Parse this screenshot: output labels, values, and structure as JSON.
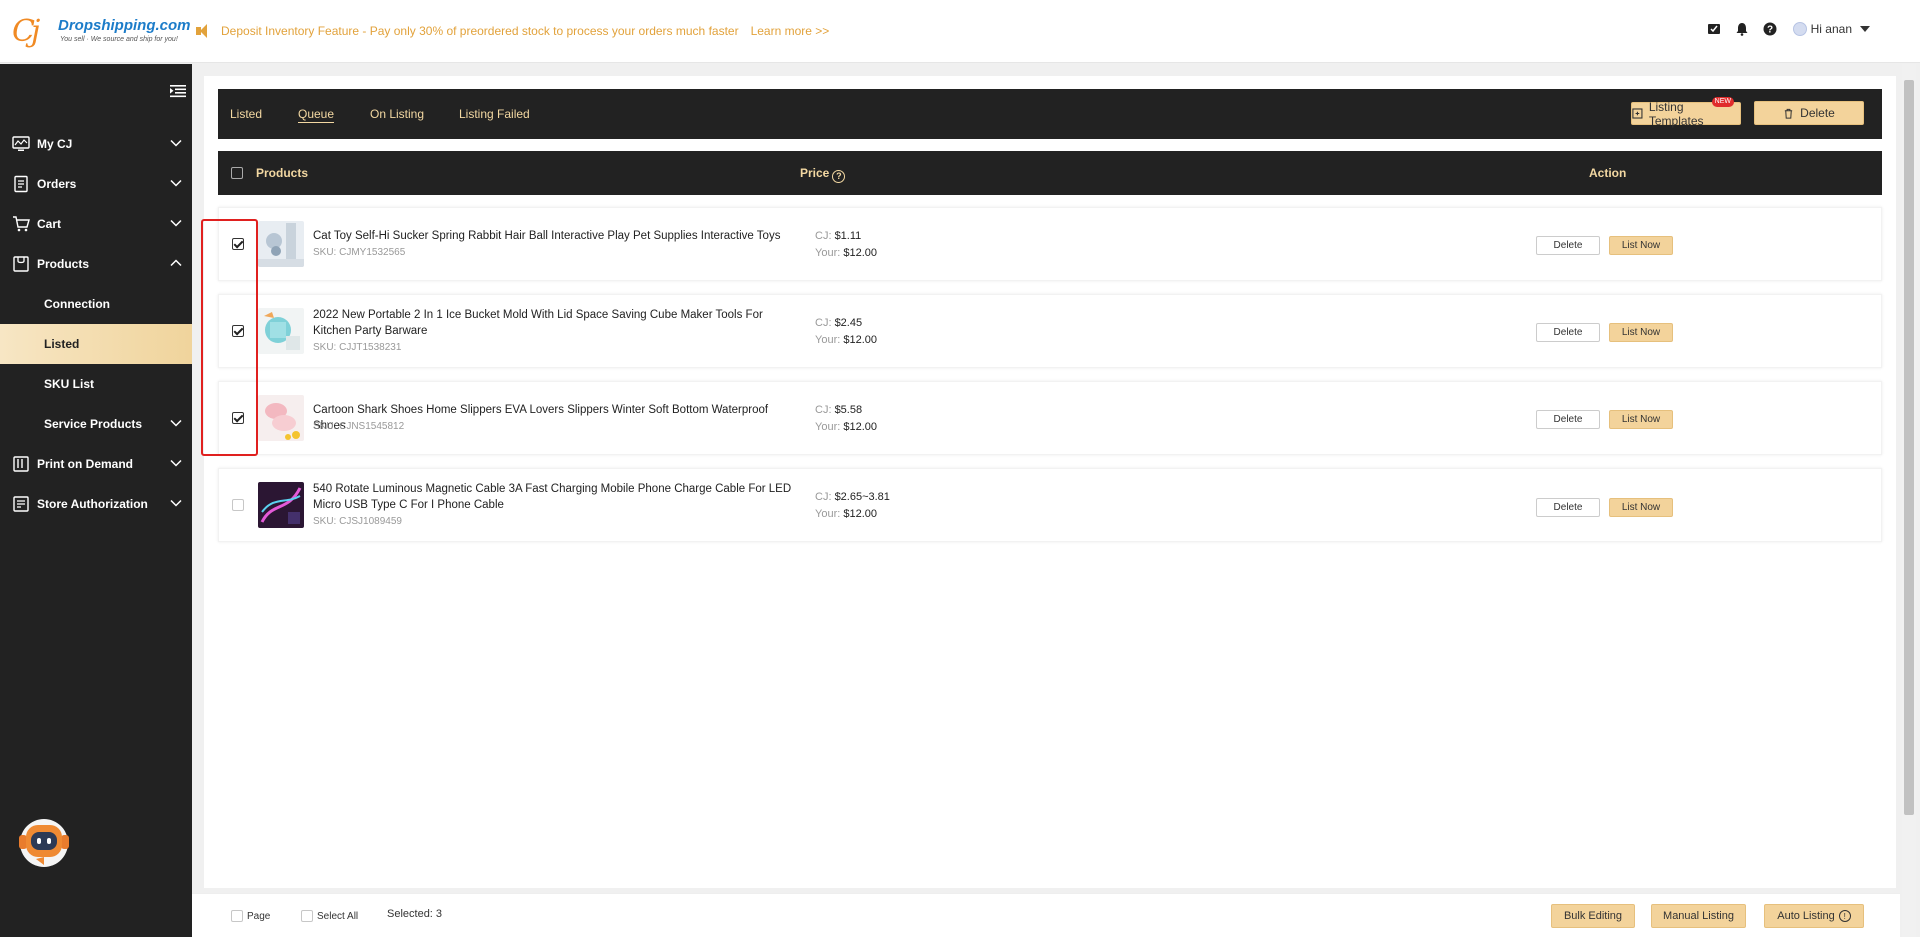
{
  "header": {
    "logo_brand": "Dropshipping.com",
    "logo_tagline": "You sell · We source and ship for you!",
    "announcement": "Deposit Inventory Feature - Pay only 30% of preordered stock to process your orders much faster",
    "learn_more": "Learn more >>",
    "greeting": "Hi anan",
    "icons": [
      "message-icon",
      "bell-icon",
      "help-icon"
    ]
  },
  "sidebar": {
    "items": [
      {
        "label": "My CJ",
        "icon": "monitor-icon",
        "expanded": false
      },
      {
        "label": "Orders",
        "icon": "orders-icon",
        "expanded": false
      },
      {
        "label": "Cart",
        "icon": "cart-icon",
        "expanded": false
      },
      {
        "label": "Products",
        "icon": "products-icon",
        "expanded": true
      },
      {
        "label": "Print on Demand",
        "icon": "pod-icon",
        "expanded": false
      },
      {
        "label": "Store Authorization",
        "icon": "store-icon",
        "expanded": false
      }
    ],
    "sub_items": [
      {
        "label": "Connection"
      },
      {
        "label": "Listed",
        "active": true
      },
      {
        "label": "SKU List"
      },
      {
        "label": "Service Products"
      }
    ]
  },
  "tabs": [
    {
      "label": "Listed"
    },
    {
      "label": "Queue",
      "active": true
    },
    {
      "label": "On Listing"
    },
    {
      "label": "Listing Failed"
    }
  ],
  "toolbar": {
    "templates_label": "Listing Templates",
    "new_badge": "NEW",
    "delete_label": "Delete"
  },
  "table": {
    "headers": {
      "products": "Products",
      "price": "Price",
      "action": "Action"
    },
    "rows": [
      {
        "name": "Cat Toy Self-Hi Sucker Spring Rabbit Hair Ball Interactive Play Pet Supplies Interactive Toys",
        "sku": "SKU: CJMY1532565",
        "cj_label": "CJ:",
        "cj_price": "$1.11",
        "your_label": "Your:",
        "your_price": "$12.00",
        "checked": true,
        "delete": "Delete",
        "list": "List Now"
      },
      {
        "name": "2022 New Portable 2 In 1 Ice Bucket Mold With Lid Space Saving Cube Maker Tools For Kitchen Party Barware",
        "sku": "SKU: CJJT1538231",
        "cj_label": "CJ:",
        "cj_price": "$2.45",
        "your_label": "Your:",
        "your_price": "$12.00",
        "checked": true,
        "delete": "Delete",
        "list": "List Now"
      },
      {
        "name": "Cartoon Shark Shoes Home Slippers EVA Lovers Slippers Winter Soft Bottom Waterproof Shoes",
        "sku": "SKU: CJNS1545812",
        "cj_label": "CJ:",
        "cj_price": "$5.58",
        "your_label": "Your:",
        "your_price": "$12.00",
        "checked": true,
        "delete": "Delete",
        "list": "List Now"
      },
      {
        "name": "540 Rotate Luminous Magnetic Cable 3A Fast Charging Mobile Phone Charge Cable For LED Micro USB Type C For I Phone Cable",
        "sku": "SKU: CJSJ1089459",
        "cj_label": "CJ:",
        "cj_price": "$2.65~3.81",
        "your_label": "Your:",
        "your_price": "$12.00",
        "checked": false,
        "delete": "Delete",
        "list": "List Now"
      }
    ]
  },
  "footer": {
    "page_label": "Page",
    "select_all_label": "Select All",
    "selected_text": "Selected: 3",
    "bulk_editing": "Bulk Editing",
    "manual_listing": "Manual Listing",
    "auto_listing": "Auto Listing"
  },
  "colors": {
    "accent": "#f3d39b",
    "dark": "#222222",
    "highlight": "#e0201f",
    "announce": "#e2a23b"
  }
}
